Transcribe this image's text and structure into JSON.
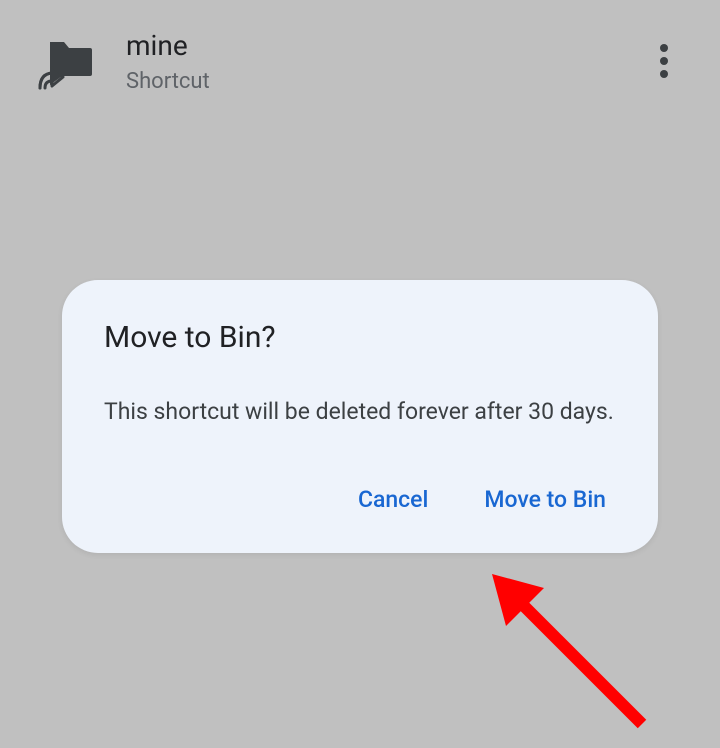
{
  "item": {
    "title": "mine",
    "subtitle": "Shortcut"
  },
  "dialog": {
    "title": "Move to Bin?",
    "body": "This shortcut will be deleted forever after 30 days.",
    "cancel_label": "Cancel",
    "confirm_label": "Move to Bin"
  },
  "colors": {
    "accent": "#1967d2",
    "annotation": "#ff0000"
  }
}
